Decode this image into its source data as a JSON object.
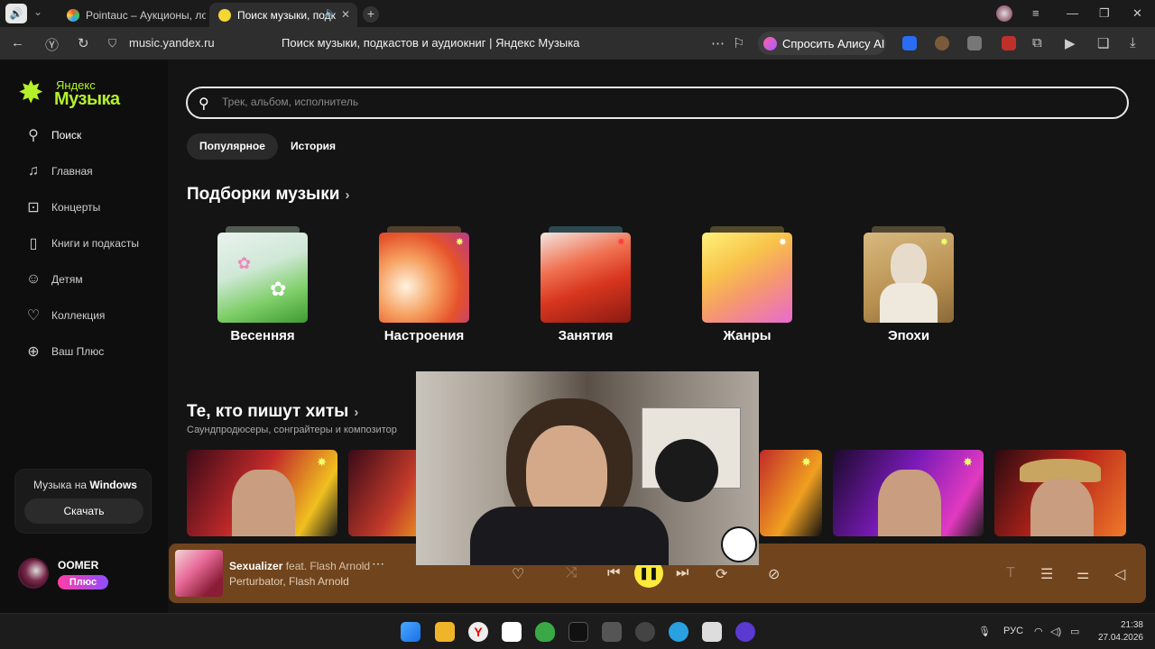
{
  "browser": {
    "tabs": [
      {
        "title": "Pointauc – Аукционы, лот",
        "active": false
      },
      {
        "title": "Поиск музыки, подк",
        "active": true
      }
    ],
    "url": "music.yandex.ru",
    "page_title": "Поиск музыки, подкастов и аудиокниг | Яндекс Музыка",
    "alice_label": "Спросить Алису AI"
  },
  "logo": {
    "line1": "Яндекс",
    "line2": "Музыка"
  },
  "sidebar": {
    "items": [
      {
        "label": "Поиск",
        "icon": "search-icon"
      },
      {
        "label": "Главная",
        "icon": "music-note-icon"
      },
      {
        "label": "Концерты",
        "icon": "ticket-icon"
      },
      {
        "label": "Книги и подкасты",
        "icon": "book-icon"
      },
      {
        "label": "Детям",
        "icon": "kids-icon"
      },
      {
        "label": "Коллекция",
        "icon": "heart-icon"
      },
      {
        "label": "Ваш Плюс",
        "icon": "plus-circle-icon"
      }
    ],
    "windows_card": {
      "text_prefix": "Музыка на ",
      "text_bold": "Windows",
      "button": "Скачать"
    },
    "user": {
      "name": "OOMER",
      "badge": "Плюс"
    }
  },
  "search": {
    "placeholder": "Трек, альбом, исполнитель",
    "value": ""
  },
  "filters": [
    {
      "label": "Популярное",
      "active": true
    },
    {
      "label": "История",
      "active": false
    }
  ],
  "collections": {
    "title": "Подборки музыки",
    "items": [
      {
        "label": "Весенняя",
        "color": "#9fd9a0"
      },
      {
        "label": "Настроения",
        "color": "#f2893d"
      },
      {
        "label": "Занятия",
        "color": "#e44f2b"
      },
      {
        "label": "Жанры",
        "color": "#f6c84a"
      },
      {
        "label": "Эпохи",
        "color": "#c49b55"
      }
    ]
  },
  "hitmakers": {
    "title": "Те, кто пишут хиты",
    "subtitle": "Саундпродюсеры, сонграйтеры и композитор"
  },
  "player": {
    "track": "Sexualizer",
    "feat": " feat. Flash Arnold",
    "artists": "Perturbator, Flash Arnold",
    "accent": "#fce93d"
  },
  "taskbar": {
    "lang": "РУС",
    "time": "21:38",
    "date": "27.04.2026"
  }
}
